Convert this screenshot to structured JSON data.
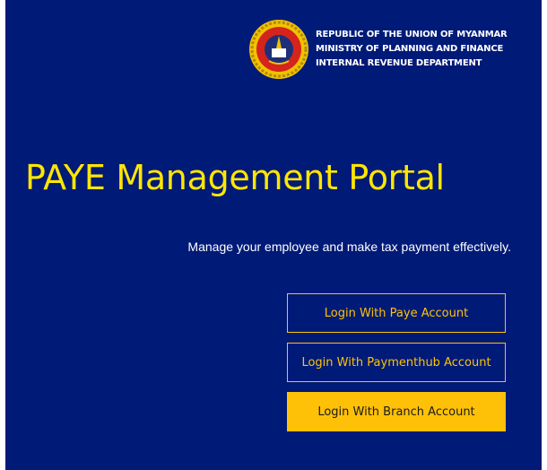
{
  "header": {
    "line1": "REPUBLIC OF THE UNION OF MYANMAR",
    "line2": "MINISTRY OF PLANNING AND FINANCE",
    "line3": "INTERNAL REVENUE DEPARTMENT",
    "emblem_icon": "department-seal-icon"
  },
  "hero": {
    "title": "PAYE Management Portal",
    "tagline": "Manage your employee and make tax payment effectively."
  },
  "buttons": {
    "paye_login": "Login With Paye Account",
    "paymenthub_login": "Login With Paymenthub Account",
    "branch_login": "Login With Branch Account"
  },
  "colors": {
    "background": "#001a78",
    "title": "#ffe600",
    "accent": "#ffc107"
  }
}
